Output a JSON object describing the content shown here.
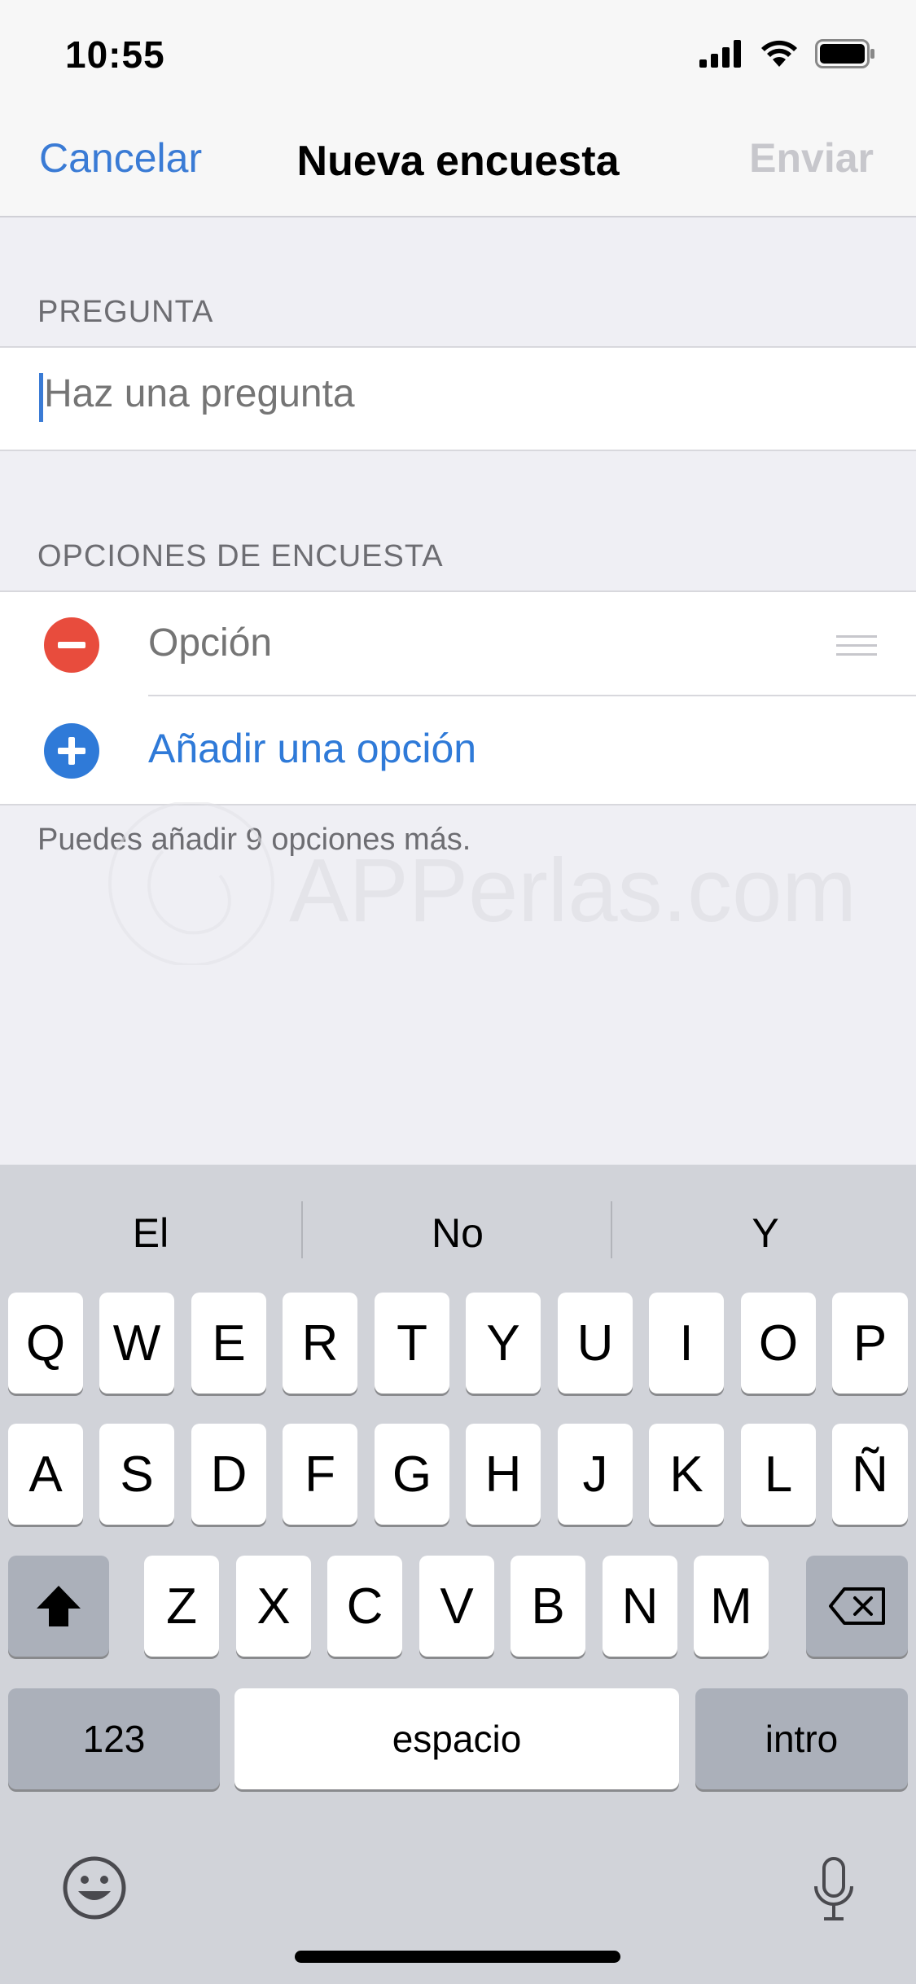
{
  "status_bar": {
    "time": "10:55"
  },
  "nav": {
    "cancel": "Cancelar",
    "title": "Nueva encuesta",
    "send": "Enviar"
  },
  "question": {
    "header": "PREGUNTA",
    "placeholder": "Haz una pregunta"
  },
  "options": {
    "header": "OPCIONES DE ENCUESTA",
    "placeholder": "Opción",
    "add_label": "Añadir una opción",
    "footer": "Puedes añadir 9 opciones más."
  },
  "watermark": {
    "text": "APPerlas.com"
  },
  "keyboard": {
    "suggestions": [
      "El",
      "No",
      "Y"
    ],
    "row1": [
      "Q",
      "W",
      "E",
      "R",
      "T",
      "Y",
      "U",
      "I",
      "O",
      "P"
    ],
    "row2": [
      "A",
      "S",
      "D",
      "F",
      "G",
      "H",
      "J",
      "K",
      "L",
      "Ñ"
    ],
    "row3": [
      "Z",
      "X",
      "C",
      "V",
      "B",
      "N",
      "M"
    ],
    "numbers": "123",
    "space": "espacio",
    "return": "intro"
  }
}
